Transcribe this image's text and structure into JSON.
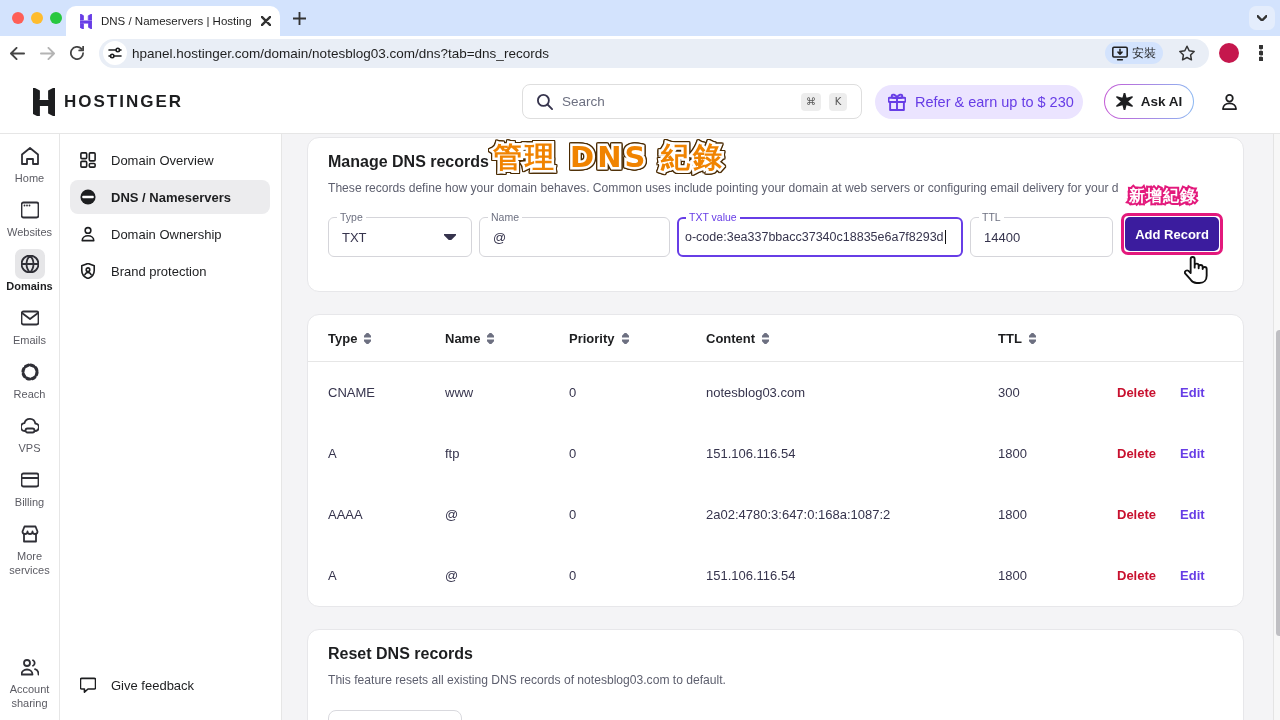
{
  "browser": {
    "tab": {
      "title": "DNS / Nameservers | Hosting"
    },
    "forward_disabled": true,
    "url": "hpanel.hostinger.com/domain/notesblog03.com/dns?tab=dns_records",
    "install_label": "安裝"
  },
  "header": {
    "logo": "HOSTINGER",
    "search": {
      "placeholder": "Search",
      "shortcut": [
        "⌘",
        "K"
      ]
    },
    "referral": "Refer & earn up to $ 230",
    "ask_ai": "Ask AI"
  },
  "rail": {
    "items": [
      {
        "label": "Home",
        "selected": false
      },
      {
        "label": "Websites",
        "selected": false
      },
      {
        "label": "Domains",
        "selected": true
      },
      {
        "label": "Emails",
        "selected": false
      },
      {
        "label": "Reach",
        "selected": false
      },
      {
        "label": "VPS",
        "selected": false
      },
      {
        "label": "Billing",
        "selected": false
      },
      {
        "label": "More services",
        "selected": false
      }
    ],
    "footer": "Account sharing"
  },
  "domain_menu": {
    "items": [
      {
        "label": "Domain Overview",
        "selected": false
      },
      {
        "label": "DNS / Nameservers",
        "selected": true
      },
      {
        "label": "Domain Ownership",
        "selected": false
      },
      {
        "label": "Brand protection",
        "selected": false
      }
    ],
    "feedback": "Give feedback"
  },
  "manage_card": {
    "title": "Manage DNS records",
    "annotation": "管理 DNS 紀錄",
    "description": "These records define how your domain behaves. Common uses include pointing your domain at web servers or configuring email delivery for your d",
    "fields": [
      {
        "kind": "select",
        "label": "Type",
        "value": "TXT",
        "focused": false
      },
      {
        "kind": "text",
        "label": "Name",
        "value": "@",
        "focused": false
      },
      {
        "kind": "text",
        "label": "TXT value",
        "value": "o-code:3ea337bbacc37340c18835e6a7f8293d",
        "focused": true
      },
      {
        "kind": "text",
        "label": "TTL",
        "value": "14400",
        "focused": false
      }
    ],
    "button": "Add Record",
    "button_annotation": "新增紀錄"
  },
  "records": {
    "columns": [
      "Type",
      "Name",
      "Priority",
      "Content",
      "TTL"
    ],
    "rows": [
      {
        "type": "CNAME",
        "name": "www",
        "priority": "0",
        "content": "notesblog03.com",
        "ttl": "300",
        "delete": "Delete",
        "edit": "Edit"
      },
      {
        "type": "A",
        "name": "ftp",
        "priority": "0",
        "content": "151.106.116.54",
        "ttl": "1800",
        "delete": "Delete",
        "edit": "Edit"
      },
      {
        "type": "AAAA",
        "name": "@",
        "priority": "0",
        "content": "2a02:4780:3:647:0:168a:1087:2",
        "ttl": "1800",
        "delete": "Delete",
        "edit": "Edit"
      },
      {
        "type": "A",
        "name": "@",
        "priority": "0",
        "content": "151.106.116.54",
        "ttl": "1800",
        "delete": "Delete",
        "edit": "Edit"
      }
    ]
  },
  "reset_card": {
    "title": "Reset DNS records",
    "description": "This feature resets all existing DNS records of notesblog03.com to default."
  }
}
